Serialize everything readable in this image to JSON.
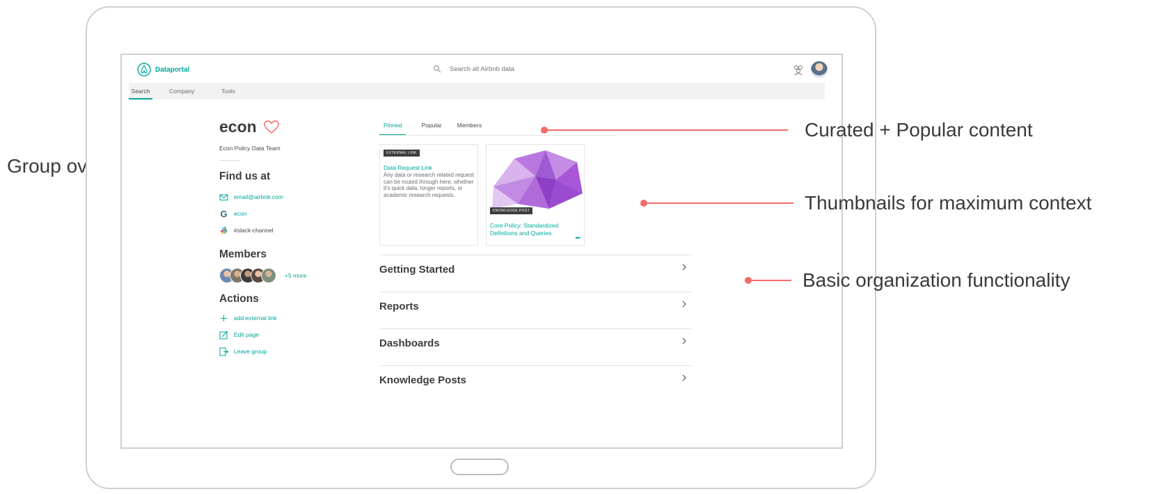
{
  "app": {
    "name": "Dataportal",
    "search_placeholder": "Search all Airbnb data"
  },
  "nav": {
    "tabs": [
      {
        "label": "Search",
        "active": true
      },
      {
        "label": "Company",
        "active": false
      },
      {
        "label": "Tools",
        "active": false
      }
    ]
  },
  "group": {
    "name": "econ",
    "description": "Econ Policy Data Team",
    "find_us_title": "Find us at",
    "email": "email@airbnb.com",
    "google_group": "econ",
    "slack_channel": "#slack-channel",
    "members_title": "Members",
    "members_more": "+5 more",
    "actions_title": "Actions",
    "actions": [
      {
        "label": "add external link",
        "icon": "plus-icon"
      },
      {
        "label": "Edit page",
        "icon": "edit-icon"
      },
      {
        "label": "Leave group",
        "icon": "leave-icon"
      }
    ]
  },
  "content_tabs": [
    {
      "label": "Pinned",
      "active": true
    },
    {
      "label": "Popular",
      "active": false
    },
    {
      "label": "Members",
      "active": false
    }
  ],
  "cards": [
    {
      "badge": "EXTERNAL LINK",
      "title": "Data Request Link",
      "body": "Any data or research related request can be routed through here, whether it's quick data, longer reports, or academic research requests."
    },
    {
      "badge": "KNOWLEDGE POST",
      "title": "Core Policy: Standardized Definitions and Queries",
      "more": "•••"
    }
  ],
  "organization": [
    "Getting Started",
    "Reports",
    "Dashboards",
    "Knowledge Posts"
  ],
  "annotations": {
    "group_overview": "Group overview",
    "curated": "Curated + Popular content",
    "thumbnails": "Thumbnails for maximum context",
    "organization": "Basic organization functionality"
  },
  "colors": {
    "accent": "#00a699",
    "brand_coral": "#ff5a5f",
    "annotation": "#f26a6a",
    "thumbnail_purple": "#a24bd0"
  }
}
